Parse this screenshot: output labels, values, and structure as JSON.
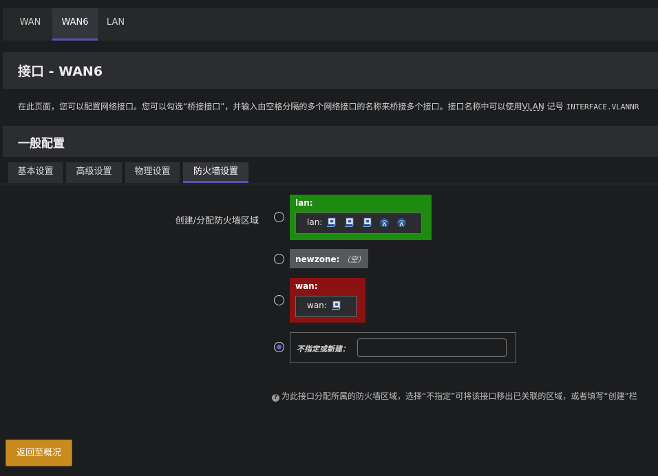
{
  "top_tabs": [
    {
      "label": "WAN",
      "active": false
    },
    {
      "label": "WAN6",
      "active": true
    },
    {
      "label": "LAN",
      "active": false
    }
  ],
  "page_title": "接口 - WAN6",
  "description": {
    "text": "在此页面，您可以配置网络接口。您可以勾选“桥接接口”，并输入由空格分隔的多个网络接口的名称来桥接多个接口。接口名称中可以使用",
    "abbr": "VLAN",
    "text2": " 记号 ",
    "mono": "INTERFACE.VLANNR"
  },
  "section_title": "一般配置",
  "sub_tabs": [
    {
      "label": "基本设置",
      "active": false
    },
    {
      "label": "高级设置",
      "active": false
    },
    {
      "label": "物理设置",
      "active": false
    },
    {
      "label": "防火墙设置",
      "active": true
    }
  ],
  "firewall": {
    "field_label": "创建/分配防火墙区域",
    "zones": {
      "lan": {
        "name": "lan:",
        "box_label": "lan:",
        "color": "#1e8a10",
        "icons": [
          "ethernet-port-icon",
          "ethernet-port-icon",
          "ethernet-port-icon",
          "wifi-icon",
          "wifi-icon"
        ],
        "selected": false
      },
      "newzone": {
        "name": "newzone:",
        "empty_label": "（空）",
        "color": "#55585d",
        "selected": false
      },
      "wan": {
        "name": "wan:",
        "box_label": "wan:",
        "color": "#8a1212",
        "icons": [
          "ethernet-port-icon"
        ],
        "selected": false
      }
    },
    "unspecified": {
      "label": "不指定或新建：",
      "value": "",
      "placeholder": "",
      "selected": true
    },
    "help_text": "为此接口分配所属的防火墙区域，选择“不指定”可将该接口移出已关联的区域，或者填写“创建”栏"
  },
  "back_button": "返回至概况",
  "colors": {
    "accent": "#5d4fb8",
    "button": "#c98a1e"
  }
}
